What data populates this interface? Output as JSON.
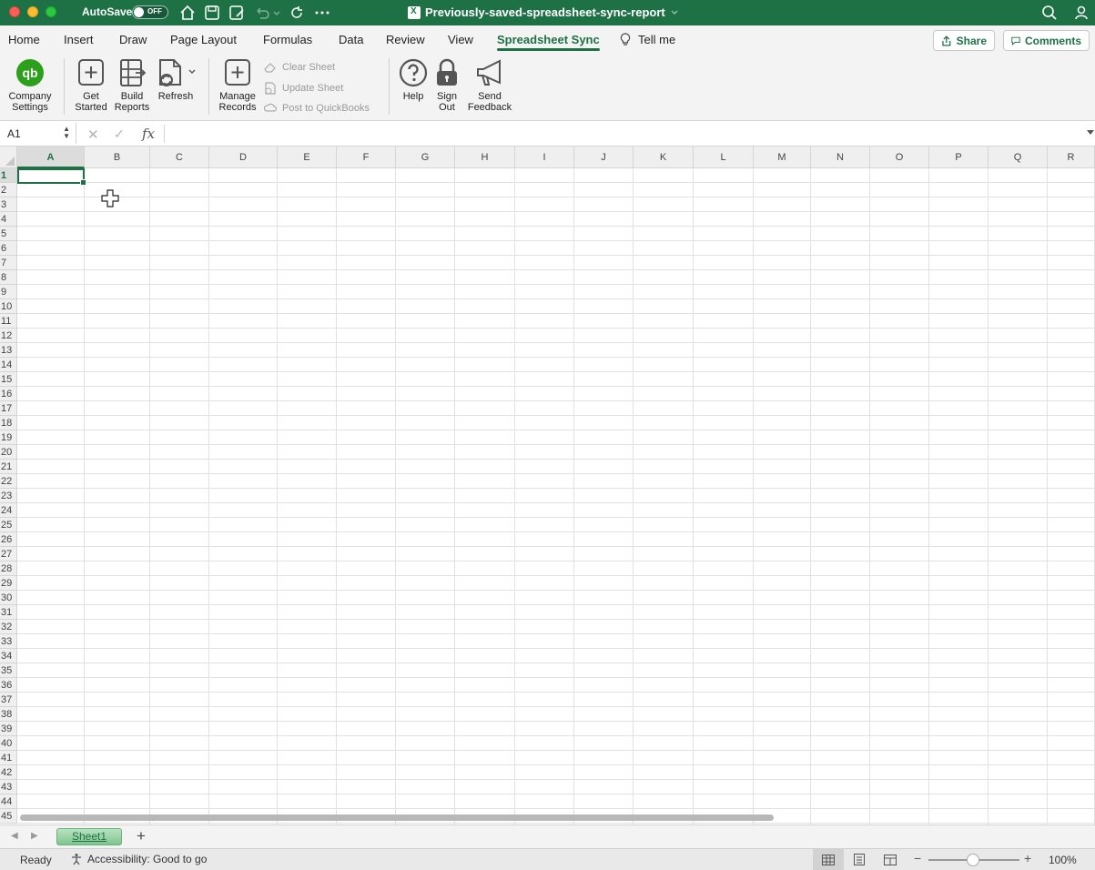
{
  "titlebar": {
    "autosave_label": "AutoSave",
    "autosave_state": "OFF",
    "document_title": "Previously-saved-spreadsheet-sync-report",
    "icons": [
      "home-icon",
      "save-icon",
      "save-as-icon",
      "undo-icon",
      "redo-icon",
      "more-icon",
      "search-icon",
      "user-icon"
    ]
  },
  "tabs": [
    {
      "label": "Home"
    },
    {
      "label": "Insert"
    },
    {
      "label": "Draw"
    },
    {
      "label": "Page Layout"
    },
    {
      "label": "Formulas"
    },
    {
      "label": "Data"
    },
    {
      "label": "Review"
    },
    {
      "label": "View"
    },
    {
      "label": "Spreadsheet Sync",
      "active": true
    },
    {
      "label": "Tell me"
    }
  ],
  "header_actions": {
    "share_label": "Share",
    "comments_label": "Comments"
  },
  "ribbon": {
    "company_settings": {
      "line1": "Company",
      "line2": "Settings"
    },
    "get_started": {
      "line1": "Get",
      "line2": "Started"
    },
    "build_reports": {
      "line1": "Build",
      "line2": "Reports"
    },
    "refresh": {
      "line1": "Refresh"
    },
    "manage_records": {
      "line1": "Manage",
      "line2": "Records"
    },
    "clear_sheet": "Clear Sheet",
    "update_sheet": "Update Sheet",
    "post_to_quickbooks": "Post to QuickBooks",
    "help": {
      "line1": "Help"
    },
    "sign_out": {
      "line1": "Sign",
      "line2": "Out"
    },
    "send_feedback": {
      "line1": "Send",
      "line2": "Feedback"
    }
  },
  "formula_bar": {
    "name_box": "A1",
    "fx_label": "fx",
    "formula": ""
  },
  "grid": {
    "columns": [
      "A",
      "B",
      "C",
      "D",
      "E",
      "F",
      "G",
      "H",
      "I",
      "J",
      "K",
      "L",
      "M",
      "N",
      "O",
      "P",
      "Q",
      "R"
    ],
    "rows": [
      "1",
      "2",
      "3",
      "4",
      "5",
      "6",
      "7",
      "8",
      "9",
      "10",
      "11",
      "12",
      "13",
      "14",
      "15",
      "16",
      "17",
      "18",
      "19",
      "20",
      "21",
      "22",
      "23",
      "24",
      "25",
      "26",
      "27",
      "28",
      "29",
      "30",
      "31",
      "32",
      "33",
      "34",
      "35",
      "36",
      "37",
      "38",
      "39",
      "40",
      "41",
      "42",
      "43",
      "44",
      "45"
    ],
    "selected_cell": "A1"
  },
  "sheets": [
    {
      "label": "Sheet1",
      "active": true
    }
  ],
  "status": {
    "ready": "Ready",
    "accessibility": "Accessibility: Good to go",
    "zoom": "100%"
  },
  "colors": {
    "accent": "#1e7145",
    "quickbooks_green": "#2ca01c"
  }
}
